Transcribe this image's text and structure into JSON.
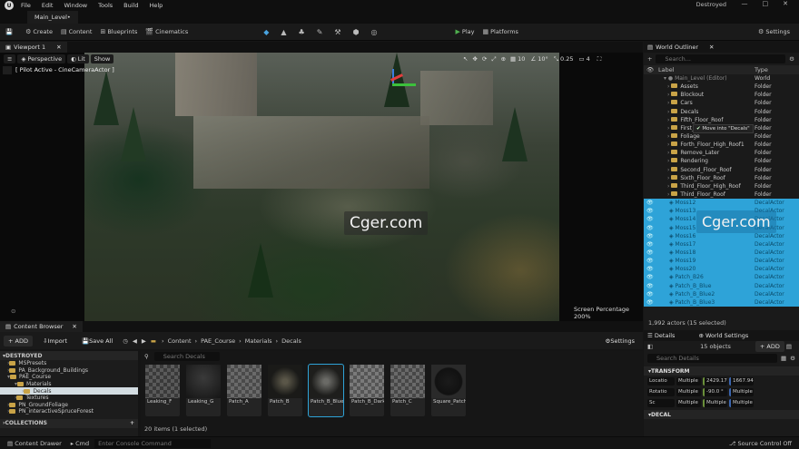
{
  "menubar": {
    "logo": "U",
    "items": [
      "File",
      "Edit",
      "Window",
      "Tools",
      "Build",
      "Help"
    ],
    "window_title": "Destroyed",
    "controls": [
      "—",
      "□",
      "✕"
    ]
  },
  "level_tab": "Main_Level•",
  "toolbar": {
    "save": "💾",
    "items": [
      "Create",
      "Content",
      "Blueprints",
      "Cinematics"
    ],
    "play": "Play",
    "platforms": "Platforms",
    "settings": "Settings"
  },
  "viewport": {
    "tab": "Viewport 1",
    "perspective": "Perspective",
    "lit": "Lit",
    "show": "Show",
    "pilot": "[ Pilot Active - CineCameraActor ]",
    "angle": "10°",
    "scale": "0.25",
    "cams": "4",
    "grid": "10",
    "screen_percentage": "Screen Percentage  200%",
    "watermark": "Cger.com"
  },
  "outliner": {
    "tab": "World Outliner",
    "search_placeholder": "Search...",
    "col_label": "Label",
    "col_type": "Type",
    "root": {
      "name": "Main_Level (Editor)",
      "type": "World"
    },
    "folders": [
      "Assets",
      "Blockout",
      "Cars",
      "Decals",
      "Fifth_Floor_Roof",
      "First_Floor_Roof",
      "Foliage",
      "Forth_Floor_High_Roof1",
      "Remove_Later",
      "Rendering",
      "Second_Floor_Roof",
      "Sixth_Floor_Roof",
      "Third_Floor_High_Roof",
      "Third_Floor_Roof"
    ],
    "folder_type": "Folder",
    "tooltip": "Move into \"Decals\"",
    "decals": [
      "Moss12",
      "Moss13",
      "Moss14",
      "Moss15",
      "Moss16",
      "Moss17",
      "Moss18",
      "Moss19",
      "Moss20",
      "Patch_B26",
      "Patch_B_Blue",
      "Patch_B_Blue2",
      "Patch_B_Blue3"
    ],
    "decal_type": "DecalActor",
    "status": "1,992 actors (15 selected)",
    "watermark": "Cger.com"
  },
  "details": {
    "tab": "Details",
    "tab2": "World Settings",
    "count": "15 objects",
    "add": "+ ADD",
    "search_placeholder": "Search Details",
    "transform": "TRANSFORM",
    "location": {
      "label": "Locatio",
      "mode": "Multiple",
      "v1": "2429.17",
      "v2": "1667.94"
    },
    "rotation": {
      "label": "Rotatio",
      "mode": "Multiple",
      "v1": "-90.0 °",
      "v2": "Multiple"
    },
    "scale": {
      "label": "Sc",
      "mode": "Multiple",
      "v1": "Multiple",
      "v2": "Multiple"
    },
    "decal": "DECAL"
  },
  "content_browser": {
    "tab": "Content Browser",
    "add": "+ ADD",
    "import": "Import",
    "save_all": "Save All",
    "path": [
      "Content",
      "PAE_Course",
      "Materials",
      "Decals"
    ],
    "settings": "Settings",
    "search_placeholder": "Search Decals",
    "count": "20 items (1 selected)",
    "tree_root": "DESTROYED",
    "tree": [
      "MSPresets",
      "PA_Background_Buildings",
      "PAE_Course",
      "Materials",
      "Decals",
      "Textures",
      "PN_GroundFoliage",
      "PN_interactiveSpruceForest"
    ],
    "collections": "COLLECTIONS",
    "assets": [
      "Leaking_F",
      "Leaking_G",
      "Patch_A",
      "Patch_B",
      "Patch_B_Blue",
      "Patch_B_Dark",
      "Patch_C",
      "Square_Patch"
    ]
  },
  "statusbar": {
    "drawer": "Content Drawer",
    "cmd": "Cmd",
    "console_placeholder": "Enter Console Command",
    "source": "Source Control Off"
  }
}
